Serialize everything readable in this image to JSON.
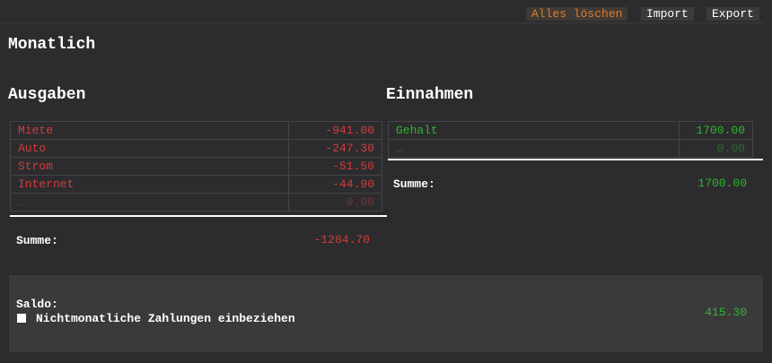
{
  "toolbar": {
    "clear_label": "Alles löschen",
    "import_label": "Import",
    "export_label": "Export"
  },
  "page": {
    "title": "Monatlich"
  },
  "expenses": {
    "heading": "Ausgaben",
    "rows": [
      {
        "name": "Miete",
        "amount": "-941.00"
      },
      {
        "name": "Auto",
        "amount": "-247.30"
      },
      {
        "name": "Strom",
        "amount": "-51.50"
      },
      {
        "name": "Internet",
        "amount": "-44.90"
      }
    ],
    "placeholder": {
      "name": "…",
      "amount": "0.00"
    },
    "sum_label": "Summe:",
    "sum_value": "-1284.70"
  },
  "income": {
    "heading": "Einnahmen",
    "rows": [
      {
        "name": "Gehalt",
        "amount": "1700.00"
      }
    ],
    "placeholder": {
      "name": "…",
      "amount": "0.00"
    },
    "sum_label": "Summe:",
    "sum_value": "1700.00"
  },
  "balance": {
    "label": "Saldo:",
    "checkbox_label": "Nichtmonatliche Zahlungen einbeziehen",
    "checkbox_checked": false,
    "value": "415.30"
  },
  "colors": {
    "background": "#2c2c2e",
    "expense": "#d43c3c",
    "income": "#2fb52f",
    "clear_accent": "#e07b2a"
  }
}
